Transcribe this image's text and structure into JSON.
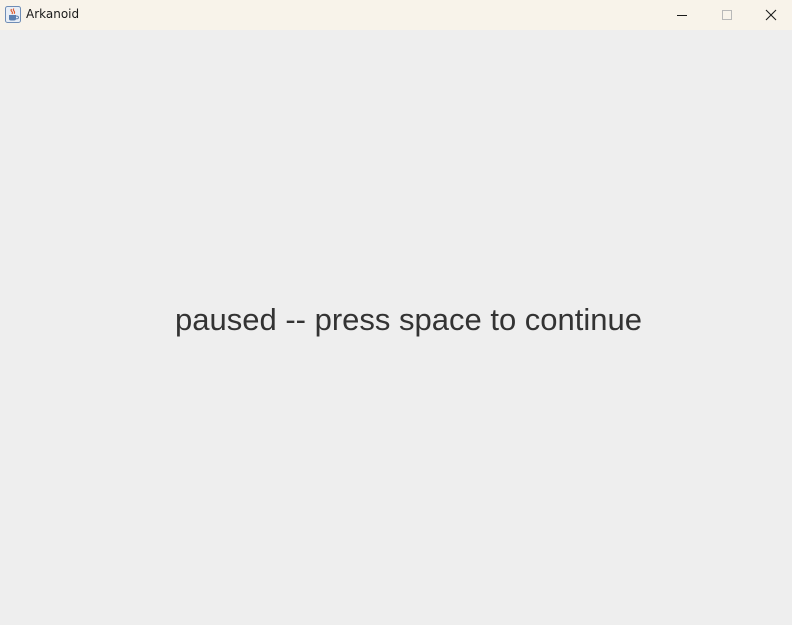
{
  "window": {
    "title": "Arkanoid",
    "icon": "java-coffee-cup-icon",
    "controls": {
      "minimize_icon": "minimize-icon",
      "maximize_icon": "maximize-icon",
      "close_icon": "close-icon"
    },
    "titlebar_color": "#f8f3ea"
  },
  "game": {
    "background_color": "#eeeeee",
    "text_color": "#333333",
    "message": "paused -- press space to continue"
  }
}
